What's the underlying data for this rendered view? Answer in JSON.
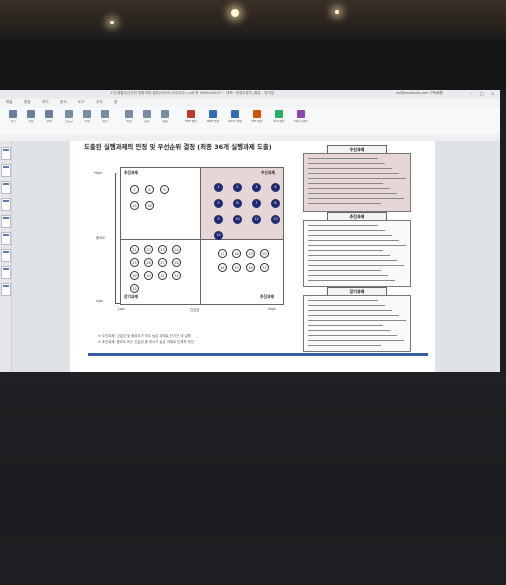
{
  "window": {
    "title": "1)단계별우선순위 영향과제 결정(비오틱,비주리오) .pdf 한 HWindeR10 ~ 대학~경영우용자_빠른 - 방의성",
    "account": "ssi@example.com 구독회원"
  },
  "menu": [
    "파일",
    "편집",
    "보기",
    "문서",
    "도구",
    "주석",
    "창"
  ],
  "ribbon": [
    {
      "label": "열기",
      "color": "#6a7f9c"
    },
    {
      "label": "저장",
      "color": "#6a7f9c"
    },
    {
      "label": "인쇄",
      "color": "#6a7f9c"
    },
    {
      "label": "손도구",
      "color": "#7a8ba4"
    },
    {
      "label": "선택",
      "color": "#7a8ba4"
    },
    {
      "label": "회전",
      "color": "#7a8ba4"
    },
    {
      "label": "확대",
      "color": "#7a8ba4"
    },
    {
      "label": "축소",
      "color": "#7a8ba4"
    },
    {
      "label": "맞춤",
      "color": "#7a8ba4"
    },
    {
      "label": "PDF 변환",
      "color": "#c0392b"
    },
    {
      "label": "HWP 변환",
      "color": "#2e6db4"
    },
    {
      "label": "DOCX 변환",
      "color": "#2e6db4"
    },
    {
      "label": "PPT 변환",
      "color": "#d35400"
    },
    {
      "label": "XLS 변환",
      "color": "#27ae60"
    },
    {
      "label": "이미지 변환",
      "color": "#8e44ad"
    }
  ],
  "document": {
    "title": "도출된 실행과제의 안정 및 우선순위 결정 (최종 36개 실행과제 도출)",
    "quadrants": {
      "top_left": "추진과제",
      "top_right": "우선과제",
      "bottom_left": "장기과제",
      "bottom_right": "추진과제"
    },
    "axis": {
      "y_top": "High",
      "y_mid": "중요도",
      "y_bottom": "Low",
      "x_mid": "긴급성",
      "x_right": "High",
      "x_left": "Low"
    },
    "circles": {
      "top_left": [
        "5",
        "8",
        "9",
        "15",
        "16"
      ],
      "top_right": [
        "1",
        "2",
        "3",
        "4",
        "5",
        "6",
        "7",
        "8",
        "9",
        "10",
        "12",
        "13",
        "14"
      ],
      "bottom_left": [
        "21",
        "22",
        "23",
        "24",
        "25",
        "26",
        "27",
        "28",
        "29",
        "30",
        "31",
        "32",
        "33"
      ],
      "bottom_right": [
        "17",
        "18",
        "19",
        "20",
        "34",
        "35",
        "36",
        "37"
      ]
    },
    "panels": {
      "priority": "우선과제",
      "promote": "추진과제",
      "longterm": "장기과제"
    },
    "notes": [
      "※ 우선과제: 긴급성 및 중요도가 모두 높은 과제로 단기간 내 실행",
      "※ 추진과제: 중요도 또는 긴급성 중 하나가 높은 과제로 단계적 추진"
    ]
  },
  "colors": {
    "accent_navy": "#1f2a70",
    "highlight_pink": "#e7d6d6"
  }
}
